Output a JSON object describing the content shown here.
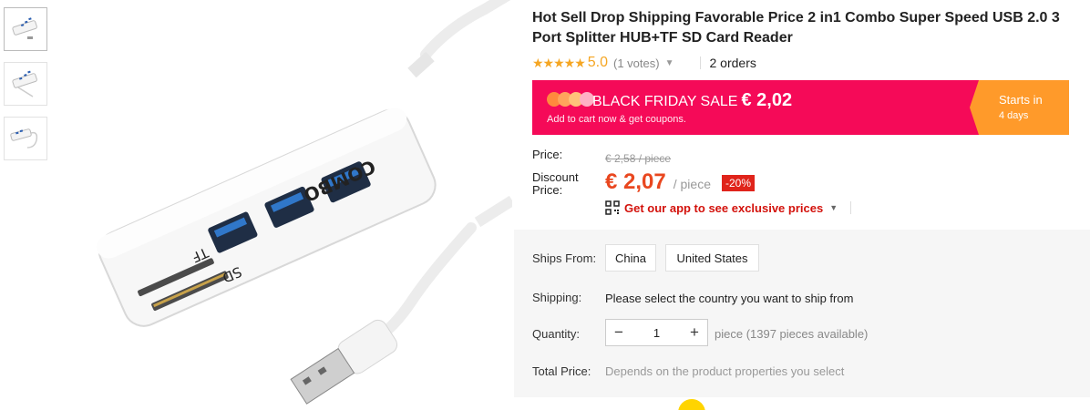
{
  "product": {
    "title": "Hot Sell Drop Shipping Favorable Price 2 in1 Combo Super Speed USB 2.0 3 Port Splitter HUB+TF SD Card Reader",
    "image_labels": {
      "sd": "SD",
      "tf": "TF",
      "brand": "COMBO"
    }
  },
  "rating": {
    "stars": "★★★★★",
    "value": "5.0",
    "votes": "(1 votes)",
    "orders": "2 orders"
  },
  "banner": {
    "title": "BLACK FRIDAY SALE",
    "price": "€ 2,02",
    "subtitle": "Add to cart now & get coupons.",
    "starts_label": "Starts in",
    "starts_value": "4 days",
    "colors": {
      "main": "#f50a58",
      "side": "#ff9a2a"
    }
  },
  "pricing": {
    "price_label": "Price:",
    "original_price": "€ 2,58 / piece",
    "discount_label": "Discount\nPrice:",
    "discount_price": "€ 2,07",
    "unit": "/ piece",
    "discount_badge": "-20%",
    "app_offer": "Get our app to see exclusive prices"
  },
  "shipping": {
    "ships_from_label": "Ships From:",
    "origins": [
      "China",
      "United States"
    ],
    "shipping_label": "Shipping:",
    "shipping_text": "Please select the country you want to ship from",
    "quantity_label": "Quantity:",
    "quantity_value": "1",
    "quantity_minus": "−",
    "quantity_plus": "+",
    "quantity_note": "piece (1397 pieces available)",
    "total_label": "Total Price:",
    "total_text": "Depends on the product properties you select"
  }
}
